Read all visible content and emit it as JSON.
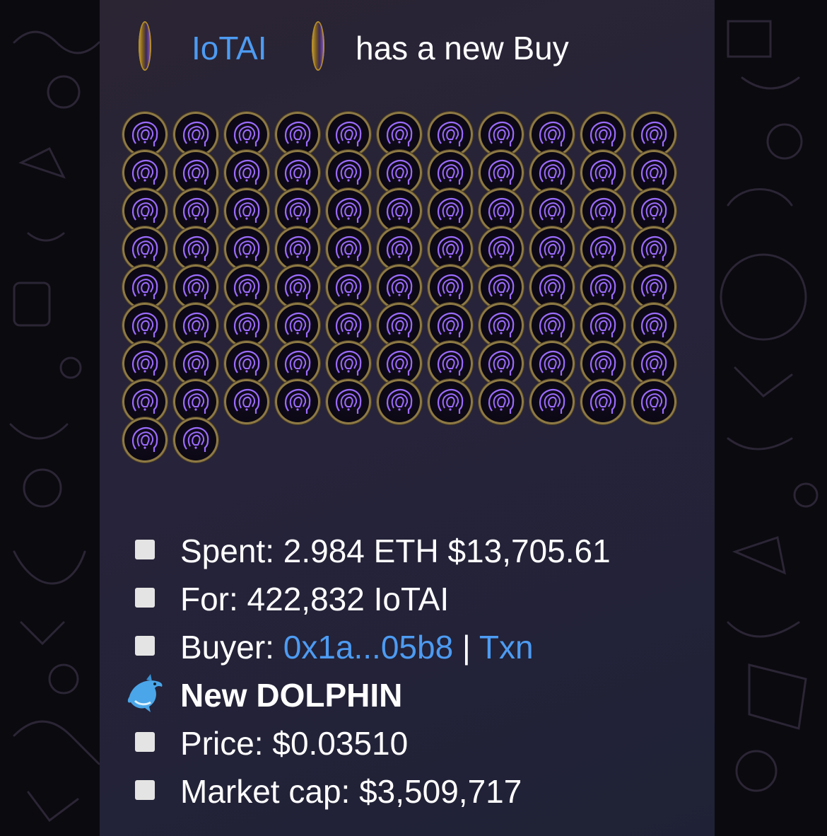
{
  "message": {
    "header": {
      "token_link": "IoTAI",
      "suffix": "has a new Buy"
    },
    "coin_grid": {
      "count": 90,
      "icon": "iotai-coin-icon"
    },
    "details": [
      {
        "icon": "white-square",
        "label": "Spent: 2.984 ETH $13,705.61"
      },
      {
        "icon": "white-square",
        "label": "For: 422,832 IoTAI"
      },
      {
        "icon": "white-square",
        "label_prefix": "Buyer: ",
        "buyer_link": "0x1a...05b8",
        "separator": " | ",
        "txn_link": "Txn"
      },
      {
        "icon": "dolphin-emoji",
        "label": "New DOLPHIN"
      },
      {
        "icon": "white-square",
        "label": "Price: $0.03510"
      },
      {
        "icon": "white-square",
        "label": "Market cap: $3,509,717"
      }
    ]
  },
  "colors": {
    "link": "#4d9bf2",
    "card_bg": "#27233a",
    "coin_rim": "#8e7a45",
    "coin_glow": "#9b6cff"
  }
}
